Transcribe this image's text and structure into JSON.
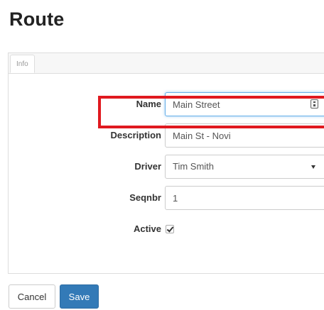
{
  "page": {
    "title": "Route"
  },
  "tabs": [
    {
      "label": "Info"
    }
  ],
  "form": {
    "name": {
      "label": "Name",
      "value": "Main Street"
    },
    "description": {
      "label": "Description",
      "value": "Main St - Novi"
    },
    "driver": {
      "label": "Driver",
      "value": "Tim Smith"
    },
    "seqnbr": {
      "label": "Seqnbr",
      "value": "1"
    },
    "active": {
      "label": "Active",
      "checked": true
    }
  },
  "buttons": {
    "cancel_label": "Cancel",
    "save_label": "Save"
  },
  "colors": {
    "primary": "#337ab7",
    "highlight": "#e0191f"
  }
}
